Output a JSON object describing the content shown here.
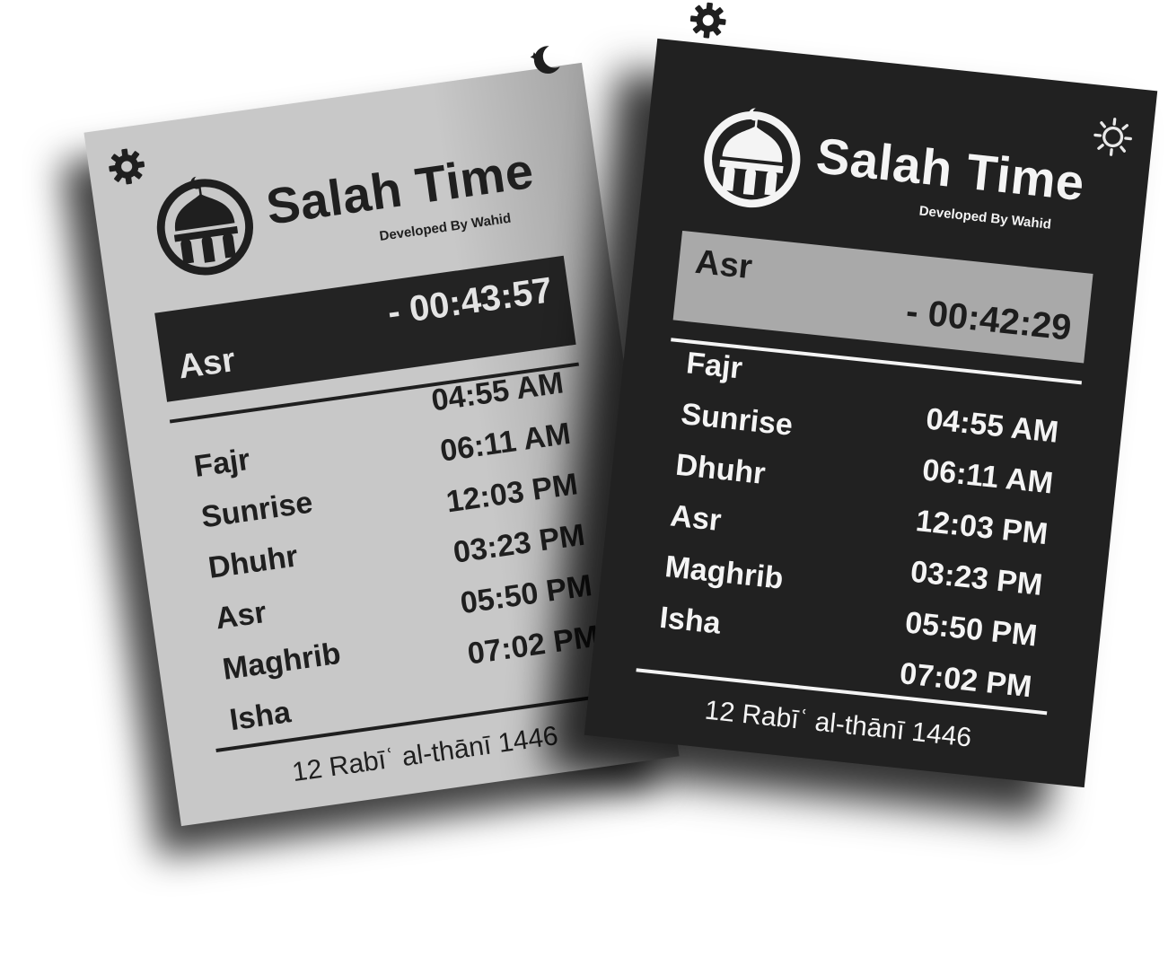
{
  "app": {
    "title": "Salah Time",
    "subtitle": "Developed By Wahid"
  },
  "light_card": {
    "theme": "light",
    "theme_toggle_icon": "moon-stars-icon",
    "settings_icon": "gear-icon",
    "next_prayer": "Asr",
    "countdown": "- 00:43:57",
    "prayers": [
      {
        "name": "Fajr",
        "time": "04:55 AM"
      },
      {
        "name": "Sunrise",
        "time": "06:11 AM"
      },
      {
        "name": "Dhuhr",
        "time": "12:03 PM"
      },
      {
        "name": "Asr",
        "time": "03:23 PM"
      },
      {
        "name": "Maghrib",
        "time": "05:50 PM"
      },
      {
        "name": "Isha",
        "time": "07:02 PM"
      }
    ],
    "hijri_date": "12 Rabīʿ al-thānī 1446"
  },
  "dark_card": {
    "theme": "dark",
    "theme_toggle_icon": "sun-icon",
    "settings_icon": "gear-icon",
    "next_prayer": "Asr",
    "countdown": "- 00:42:29",
    "prayers": [
      {
        "name": "Fajr",
        "time": "04:55 AM"
      },
      {
        "name": "Sunrise",
        "time": "06:11 AM"
      },
      {
        "name": "Dhuhr",
        "time": "12:03 PM"
      },
      {
        "name": "Asr",
        "time": "03:23 PM"
      },
      {
        "name": "Maghrib",
        "time": "05:50 PM"
      },
      {
        "name": "Isha",
        "time": "07:02 PM"
      }
    ],
    "hijri_date": "12 Rabīʿ al-thānī 1446"
  },
  "colors": {
    "light_bg": "#c8c8c8",
    "light_fg": "#1f1f1f",
    "dark_bg": "#212121",
    "dark_fg": "#f4f4f4",
    "dark_countdown_bg": "#a9a9a9",
    "light_countdown_bg": "#232323"
  }
}
